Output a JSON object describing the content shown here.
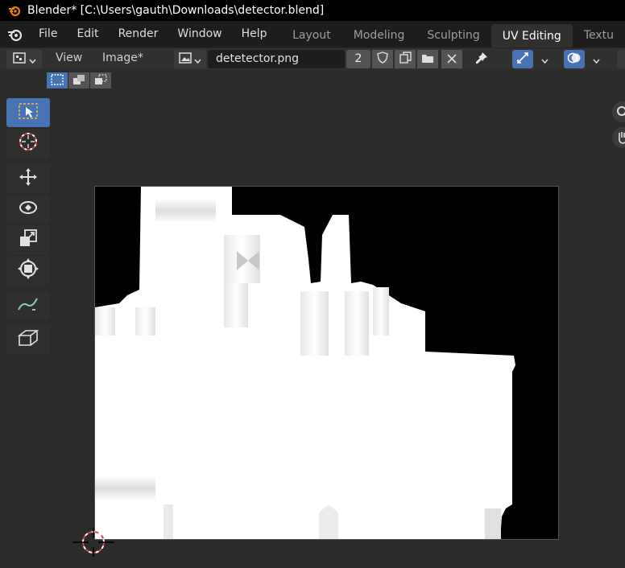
{
  "window": {
    "title": "Blender* [C:\\Users\\gauth\\Downloads\\detector.blend]"
  },
  "menu": {
    "items": [
      "File",
      "Edit",
      "Render",
      "Window",
      "Help"
    ]
  },
  "workspaces": {
    "tabs": [
      "Layout",
      "Modeling",
      "Sculpting",
      "UV Editing",
      "Textu"
    ],
    "active": "UV Editing"
  },
  "header": {
    "editor_type_icon": "uv-editor-icon",
    "view_label": "View",
    "image_label": "Image*",
    "image_name": "detetector.png",
    "user_count": "2"
  },
  "colors": {
    "accent": "#4772b3",
    "background": "#2b2b2b",
    "titlebar": "#000000",
    "image_black": "#000000",
    "image_white": "#ffffff"
  },
  "tools": [
    {
      "name": "select-box-tool",
      "icon": "select-box-icon",
      "active": true
    },
    {
      "name": "cursor-tool",
      "icon": "cursor-icon",
      "active": false
    },
    {
      "name": "move-tool",
      "icon": "move-icon",
      "active": false
    },
    {
      "name": "rotate-tool",
      "icon": "rotate-icon",
      "active": false
    },
    {
      "name": "scale-tool",
      "icon": "scale-icon",
      "active": false
    },
    {
      "name": "transform-tool",
      "icon": "transform-icon",
      "active": false
    },
    {
      "name": "annotate-tool",
      "icon": "annotate-icon",
      "active": false
    },
    {
      "name": "grab-tool",
      "icon": "grab-icon",
      "active": false
    }
  ]
}
